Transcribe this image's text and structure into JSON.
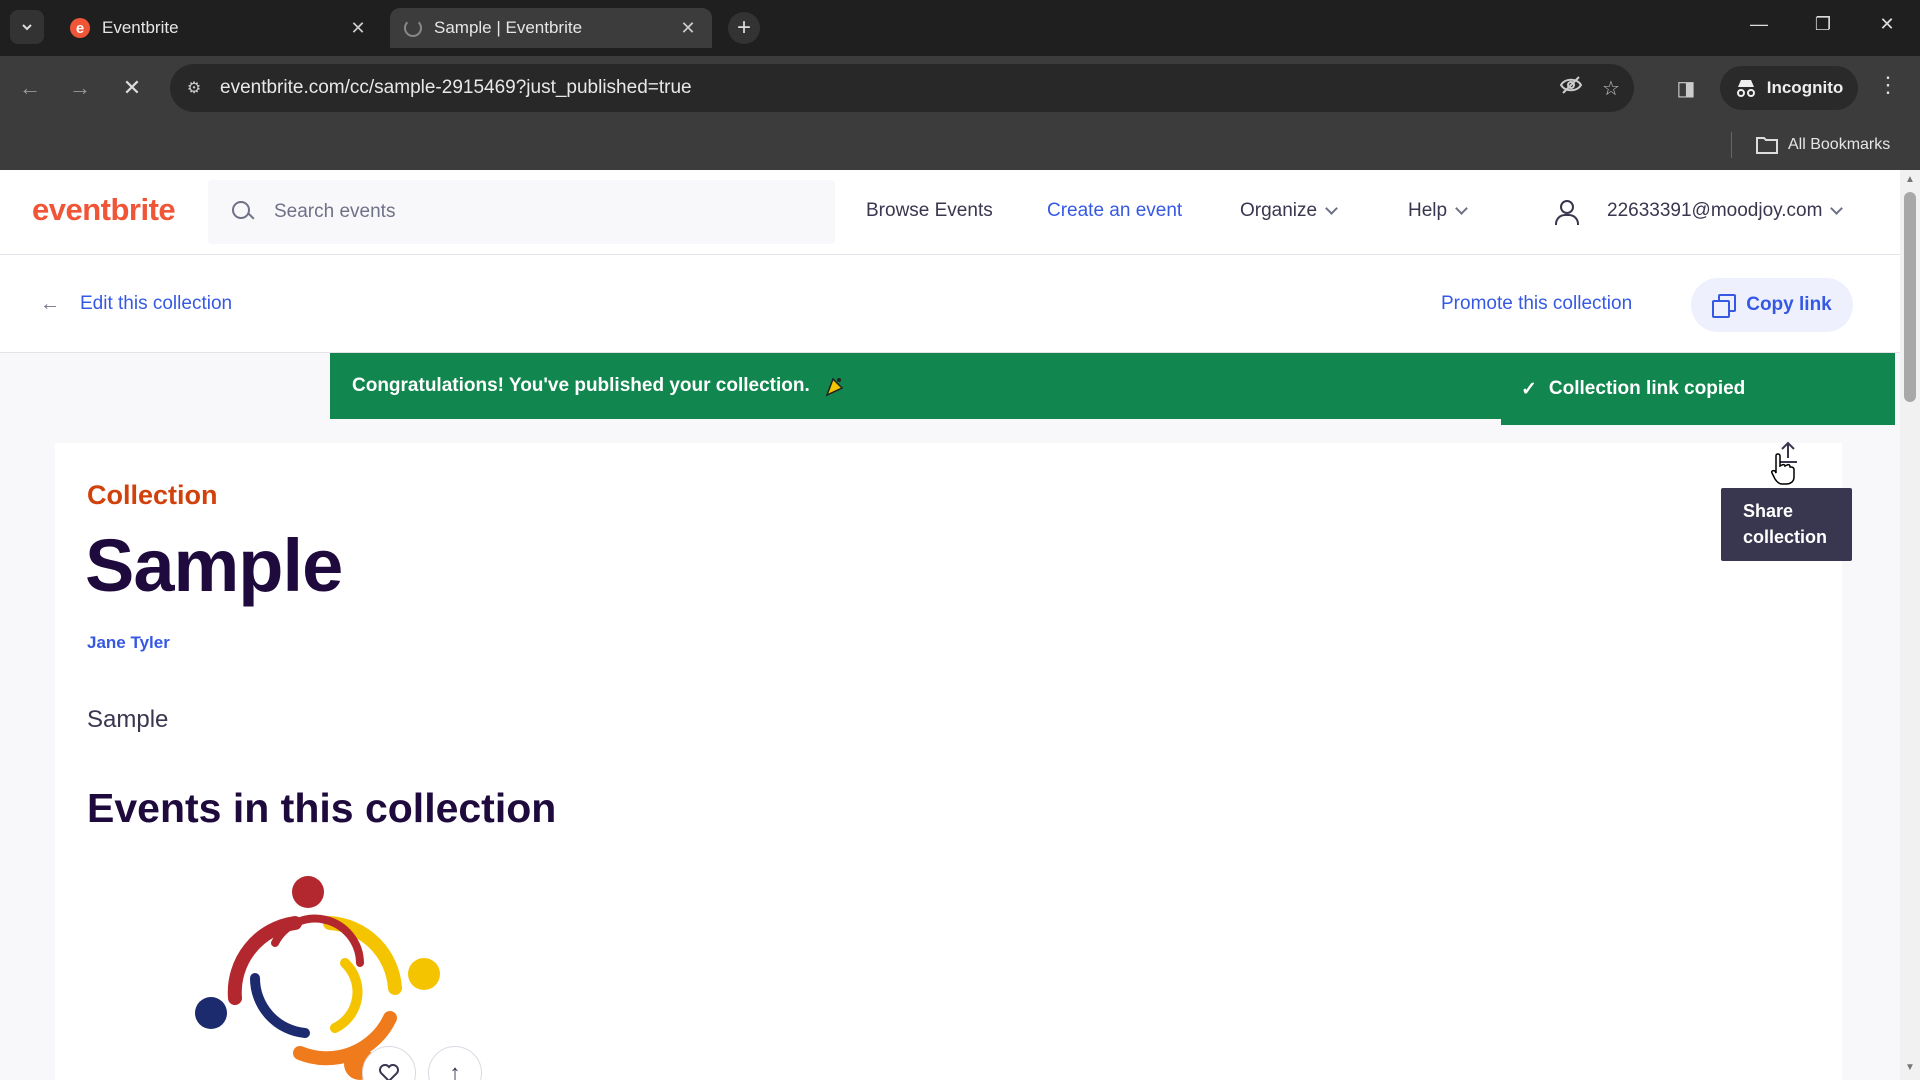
{
  "browser": {
    "tabs": [
      {
        "title": "Eventbrite",
        "active": false
      },
      {
        "title": "Sample | Eventbrite",
        "active": true
      }
    ],
    "url": "eventbrite.com/cc/sample-2915469?just_published=true",
    "incognito_label": "Incognito",
    "bookmarks_label": "All Bookmarks"
  },
  "header": {
    "logo": "eventbrite",
    "search_placeholder": "Search events",
    "nav": {
      "browse": "Browse Events",
      "create": "Create an event",
      "organize": "Organize",
      "help": "Help"
    },
    "user_email": "22633391@moodjoy.com"
  },
  "subheader": {
    "edit_label": "Edit this collection",
    "promote_label": "Promote this collection",
    "copy_label": "Copy link"
  },
  "banner": {
    "message": "Congratulations! You've published your collection.",
    "toast": "Collection link copied"
  },
  "collection": {
    "eyebrow": "Collection",
    "title": "Sample",
    "organizer": "Jane Tyler",
    "description": "Sample",
    "events_heading": "Events in this collection"
  },
  "tooltip": {
    "line1": "Share",
    "line2": "collection"
  },
  "colors": {
    "brand": "#f05537",
    "link": "#3659e3",
    "success": "#11864f",
    "heading": "#1e0a3c",
    "eyebrow": "#d1410c"
  }
}
